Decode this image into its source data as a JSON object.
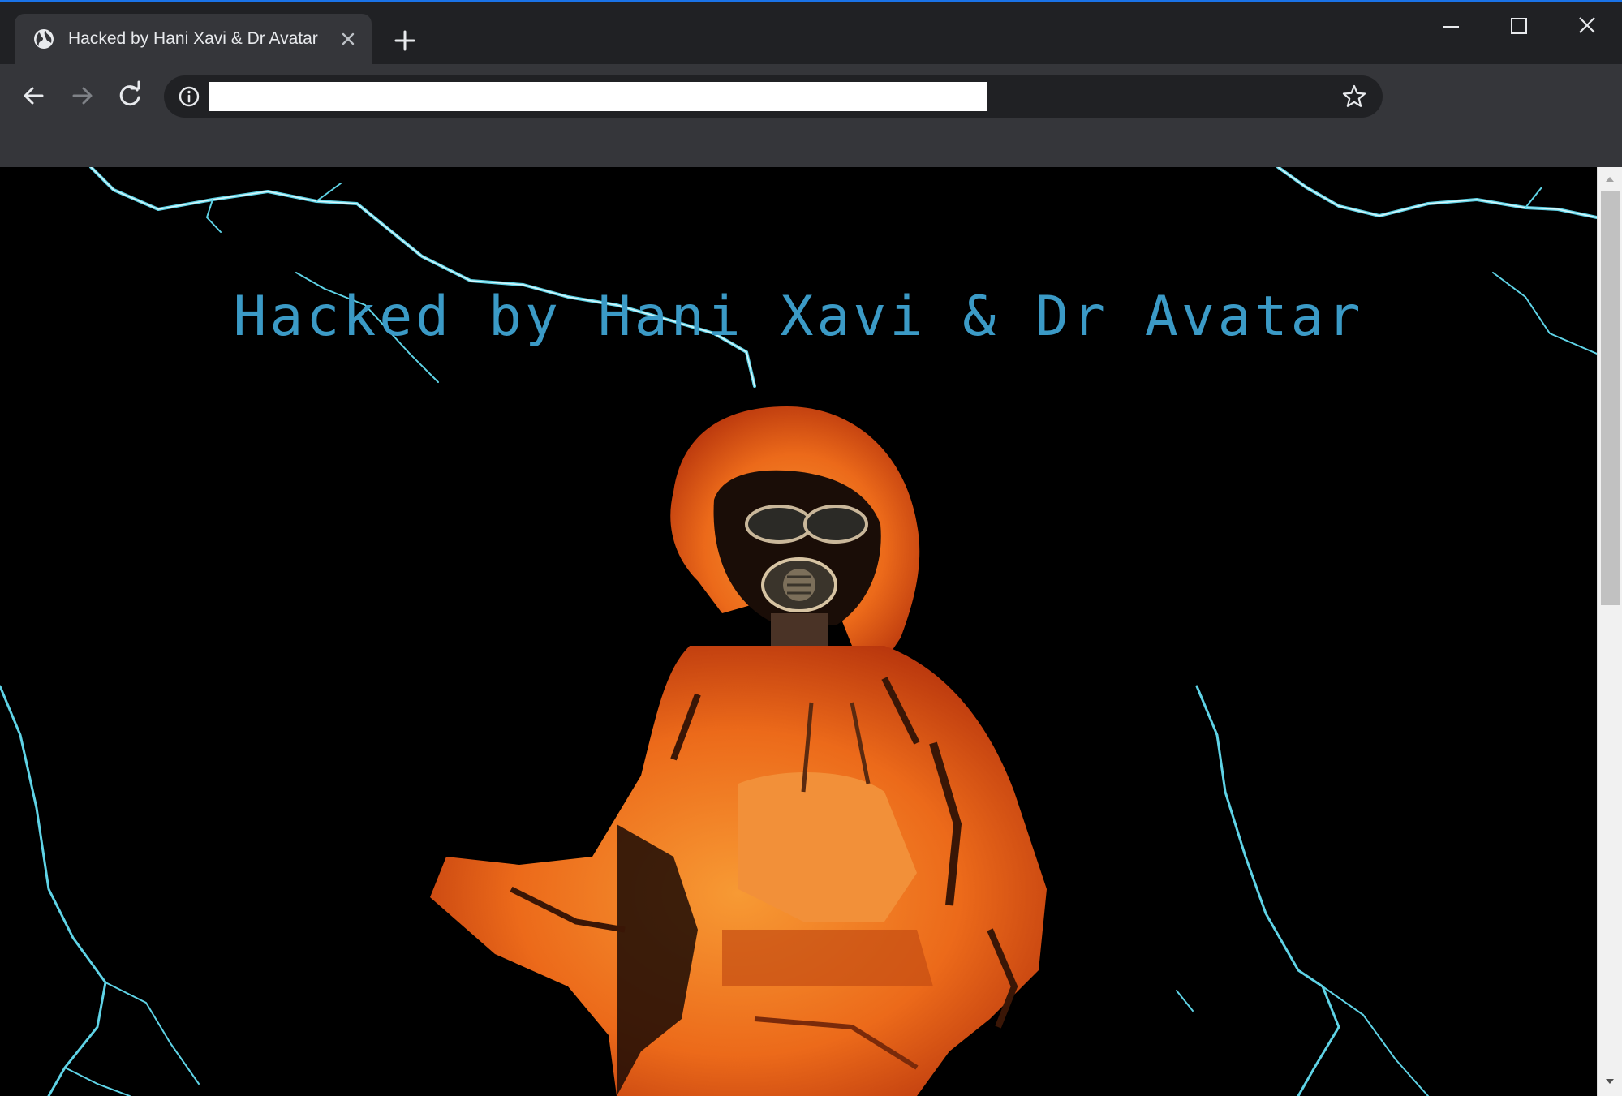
{
  "browser": {
    "tab": {
      "title": "Hacked by Hani Xavi & Dr Avatar",
      "favicon": "globe-icon"
    },
    "window_controls": [
      "minimize-icon",
      "maximize-icon",
      "close-icon"
    ],
    "toolbar": {
      "nav_icons": [
        "back-arrow-icon",
        "forward-arrow-icon",
        "reload-icon"
      ],
      "address": {
        "value": "",
        "leading_icon": "info-icon",
        "trailing_icon": "star-icon"
      }
    }
  },
  "page": {
    "heading": "Hacked by Hani Xavi & Dr Avatar",
    "background_image": "hooded figure in orange hoodie wearing gas mask with lightning"
  },
  "colors": {
    "heading": "#3b9ac6",
    "lightning": "#5fd3e6",
    "hoodie": "#f07a1e",
    "chrome_dark": "#202124",
    "chrome_light": "#35363a",
    "accent": "#1a73e8"
  }
}
